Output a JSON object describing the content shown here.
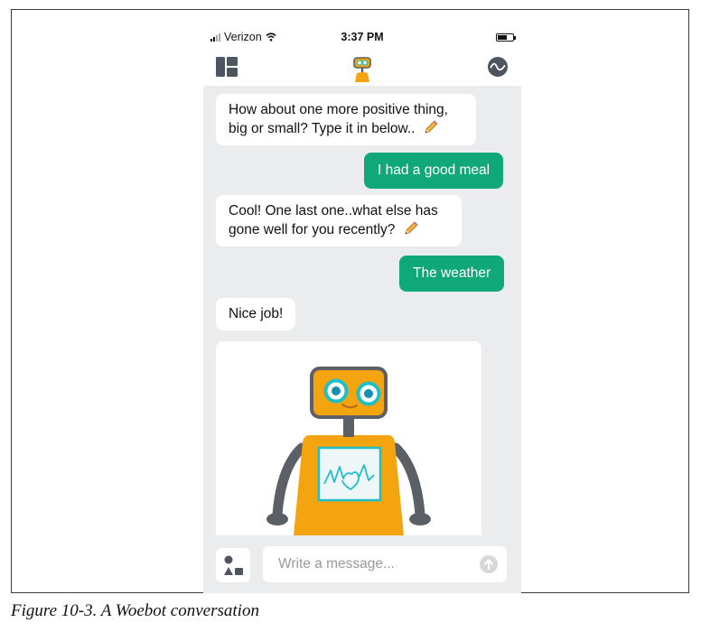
{
  "status_bar": {
    "carrier": "Verizon",
    "time": "3:37 PM"
  },
  "nav": {
    "menu_icon": "dashboard-icon",
    "logo_icon": "woebot-logo-icon",
    "mood_icon": "mood-tracker-icon"
  },
  "messages": [
    {
      "from": "bot",
      "text": "How about one more positive thing, big or small? Type it in below..",
      "emoji": "pencil"
    },
    {
      "from": "user",
      "text": "I had a good meal"
    },
    {
      "from": "bot",
      "text": "Cool! One last one..what else has gone well for you recently?",
      "emoji": "pencil"
    },
    {
      "from": "user",
      "text": "The weather"
    },
    {
      "from": "bot",
      "text": "Nice job!"
    }
  ],
  "robot_image": "woebot-robot",
  "composer": {
    "placeholder": "Write a message...",
    "shapes_icon": "shapes-icon",
    "send_icon": "send-arrow-icon"
  },
  "colors": {
    "user_bubble": "#11a878",
    "chat_background": "#ebecee",
    "robot_orange": "#f3a40f",
    "robot_eye_ring": "#1fbfc8"
  },
  "caption": "Figure 10-3. A Woebot conversation"
}
